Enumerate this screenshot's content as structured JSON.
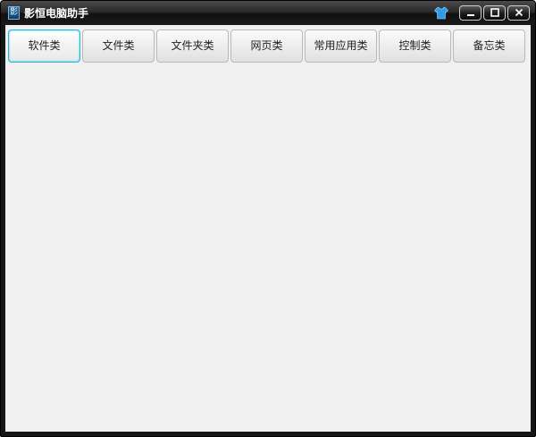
{
  "window": {
    "title": "影恒电脑助手",
    "app_icon_glyph": "影",
    "controls": {
      "minimize_icon": "minimize-icon",
      "maximize_icon": "maximize-icon",
      "close_icon": "close-icon",
      "skin_icon": "shirt-icon"
    }
  },
  "tabs": [
    {
      "label": "软件类",
      "active": true
    },
    {
      "label": "文件类"
    },
    {
      "label": "文件夹类"
    },
    {
      "label": "网页类"
    },
    {
      "label": "常用应用类"
    },
    {
      "label": "控制类"
    },
    {
      "label": "备忘类"
    }
  ],
  "colors": {
    "accent": "#1eb9d8",
    "skin_icon": "#2f9be8",
    "client_bg": "#f0f0f0"
  }
}
